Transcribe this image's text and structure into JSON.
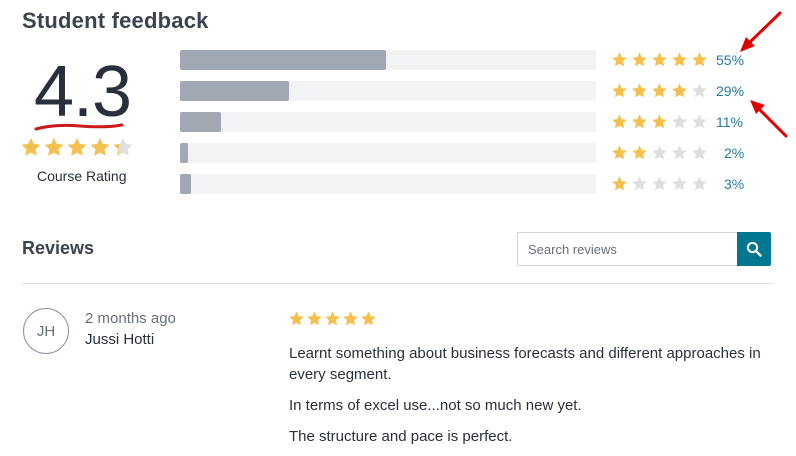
{
  "header": {
    "title": "Student feedback"
  },
  "course_rating": {
    "value": "4.3",
    "rating": 4.3,
    "caption": "Course Rating",
    "star_color": "#f4c150",
    "empty_star_color": "#dedfe0",
    "underline_color": "#cc1a1a"
  },
  "breakdown": [
    {
      "stars": 5,
      "percent": 55,
      "label": "55%"
    },
    {
      "stars": 4,
      "percent": 29,
      "label": "29%"
    },
    {
      "stars": 3,
      "percent": 11,
      "label": "11%"
    },
    {
      "stars": 2,
      "percent": 2,
      "label": "2%"
    },
    {
      "stars": 1,
      "percent": 3,
      "label": "3%"
    }
  ],
  "annotation": {
    "arrow_color": "#e00000"
  },
  "reviews": {
    "title": "Reviews",
    "search": {
      "placeholder": "Search reviews",
      "button_icon": "search-icon",
      "button_color": "#007791"
    },
    "items": [
      {
        "initials": "JH",
        "time": "2 months ago",
        "author": "Jussi Hotti",
        "stars": 5,
        "paragraphs": [
          "Learnt something about business forecasts and different approaches in every segment.",
          "In terms of excel use...not so much new yet.",
          "The structure and pace is perfect."
        ]
      }
    ]
  }
}
